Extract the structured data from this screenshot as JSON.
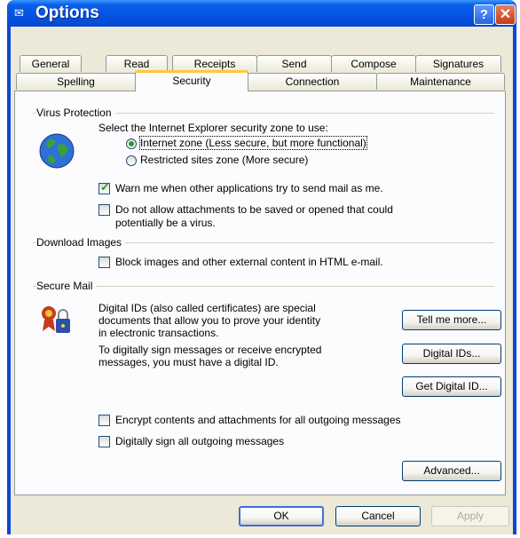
{
  "window": {
    "title": "Options"
  },
  "tabs_row1": [
    "General",
    "Read",
    "Receipts",
    "Send",
    "Compose",
    "Signatures"
  ],
  "tabs_row2": [
    "Spelling",
    "Security",
    "Connection",
    "Maintenance"
  ],
  "active_tab": "Security",
  "virus_protection": {
    "heading": "Virus Protection",
    "zone_prompt": "Select the Internet Explorer security zone to use:",
    "zone_internet": "Internet zone (Less secure, but more functional)",
    "zone_restricted": "Restricted sites zone (More secure)",
    "warn_label": "Warn me when other applications try to send mail as me.",
    "warn_checked": true,
    "block_attach_line1": "Do not allow attachments to be saved or opened that could",
    "block_attach_line2": "potentially be a virus.",
    "block_attach_checked": false
  },
  "download_images": {
    "heading": "Download Images",
    "block_images_label": "Block images and other external content in HTML e-mail.",
    "block_images_checked": false
  },
  "secure_mail": {
    "heading": "Secure Mail",
    "desc1": "Digital IDs (also called certificates) are special documents that allow you to prove your identity in electronic transactions.",
    "desc2": "To digitally sign messages or receive encrypted messages, you must have a digital ID.",
    "tell_more": "Tell me more...",
    "digital_ids": "Digital IDs...",
    "get_digital_id": "Get Digital ID...",
    "encrypt_label": "Encrypt contents and attachments for all outgoing messages",
    "sign_label": "Digitally sign all outgoing messages",
    "advanced": "Advanced..."
  },
  "footer": {
    "ok": "OK",
    "cancel": "Cancel",
    "apply": "Apply"
  }
}
